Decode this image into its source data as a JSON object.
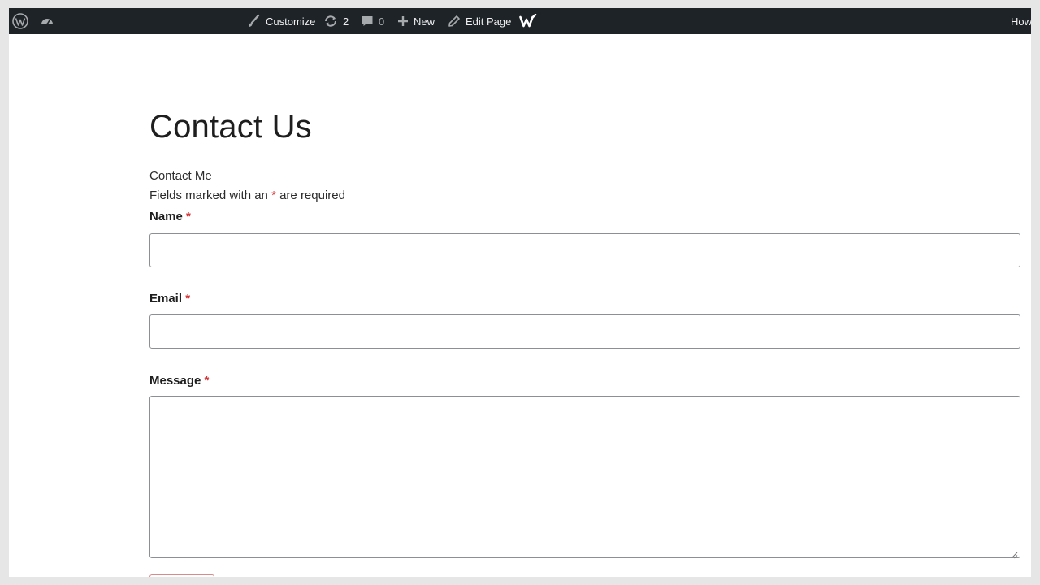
{
  "admin_bar": {
    "customize_label": "Customize",
    "updates_count": "2",
    "comments_count": "0",
    "new_label": "New",
    "edit_page_label": "Edit Page",
    "howdy_label": "Howdy",
    "background_color": "#1d2327",
    "icons": [
      "wordpress-logo-icon",
      "dashboard-icon",
      "brush-icon",
      "updates-icon",
      "comment-icon",
      "plus-icon",
      "pencil-icon",
      "wpforms-icon"
    ]
  },
  "page": {
    "title": "Contact Us"
  },
  "form": {
    "title": "Contact Me",
    "required_note_prefix": "Fields marked with an",
    "required_star": "*",
    "required_note_suffix": "are required",
    "fields": [
      {
        "label": "Name",
        "required_mark": "*",
        "value": ""
      },
      {
        "label": "Email",
        "required_mark": "*",
        "value": ""
      },
      {
        "label": "Message",
        "required_mark": "*",
        "value": ""
      }
    ],
    "accent_color": "#d63638"
  }
}
